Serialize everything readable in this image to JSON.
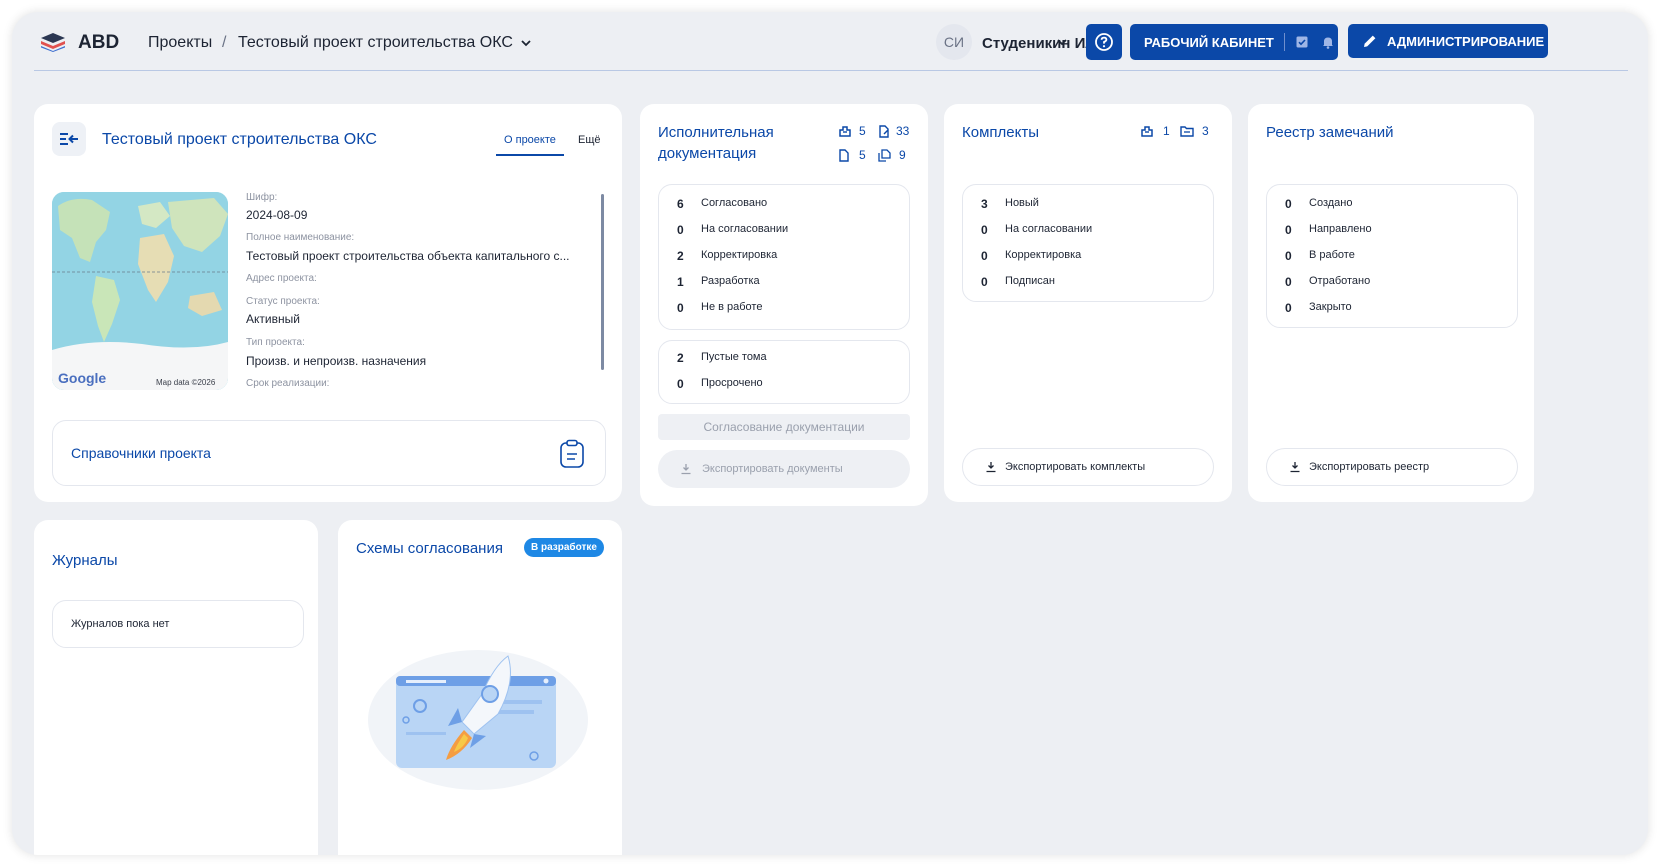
{
  "header": {
    "logo_text": "ABD",
    "breadcrumb_projects": "Проекты",
    "breadcrumb_separator": "/",
    "breadcrumb_current": "Тестовый проект строительства ОКС",
    "user_initials": "СИ",
    "user_name": "Студеникин Илья",
    "workspace_label": "РАБОЧИЙ КАБИНЕТ",
    "admin_label": "АДМИНИСТРИРОВАНИЕ"
  },
  "project_card": {
    "title": "Тестовый проект строительства ОКС",
    "tab_about": "О проекте",
    "tab_more": "Ещё",
    "map_logo": "Google",
    "map_attribution": "Map data ©2026",
    "fields": [
      {
        "label": "Шифр:",
        "value": "2024-08-09"
      },
      {
        "label": "Полное наименование:",
        "value": "Тестовый проект строительства объекта капитального с..."
      },
      {
        "label": "Адрес проекта:",
        "value": ""
      },
      {
        "label": "Статус проекта:",
        "value": "Активный"
      },
      {
        "label": "Тип проекта:",
        "value": "Произв. и непроизв. назначения"
      },
      {
        "label": "Срок реализации:",
        "value": ""
      }
    ],
    "references_label": "Справочники проекта"
  },
  "exec_docs": {
    "title_line1": "Исполнительная",
    "title_line2": "документация",
    "counters": {
      "a": "5",
      "b": "33",
      "c": "5",
      "d": "9"
    },
    "statuses": [
      {
        "count": "6",
        "label": "Согласовано"
      },
      {
        "count": "0",
        "label": "На согласовании"
      },
      {
        "count": "2",
        "label": "Корректировка"
      },
      {
        "count": "1",
        "label": "Разработка"
      },
      {
        "count": "0",
        "label": "Не в работе"
      }
    ],
    "extra": [
      {
        "count": "2",
        "label": "Пустые тома"
      },
      {
        "count": "0",
        "label": "Просрочено"
      }
    ],
    "approve_button": "Согласование документации",
    "export_button": "Экспортировать документы"
  },
  "kits": {
    "title": "Комплекты",
    "counters": {
      "a": "1",
      "b": "3"
    },
    "statuses": [
      {
        "count": "3",
        "label": "Новый"
      },
      {
        "count": "0",
        "label": "На согласовании"
      },
      {
        "count": "0",
        "label": "Корректировка"
      },
      {
        "count": "0",
        "label": "Подписан"
      }
    ],
    "export_button": "Экспортировать комплекты"
  },
  "remarks": {
    "title": "Реестр замечаний",
    "statuses": [
      {
        "count": "0",
        "label": "Создано"
      },
      {
        "count": "0",
        "label": "Направлено"
      },
      {
        "count": "0",
        "label": "В работе"
      },
      {
        "count": "0",
        "label": "Отработано"
      },
      {
        "count": "0",
        "label": "Закрыто"
      }
    ],
    "export_button": "Экспортировать реестр"
  },
  "journals": {
    "title": "Журналы",
    "empty_text": "Журналов пока нет"
  },
  "schemes": {
    "title": "Схемы согласования",
    "badge": "В разработке"
  },
  "colors": {
    "accent": "#0b48a8",
    "background": "#edeff3",
    "badge": "#1e88e5"
  }
}
